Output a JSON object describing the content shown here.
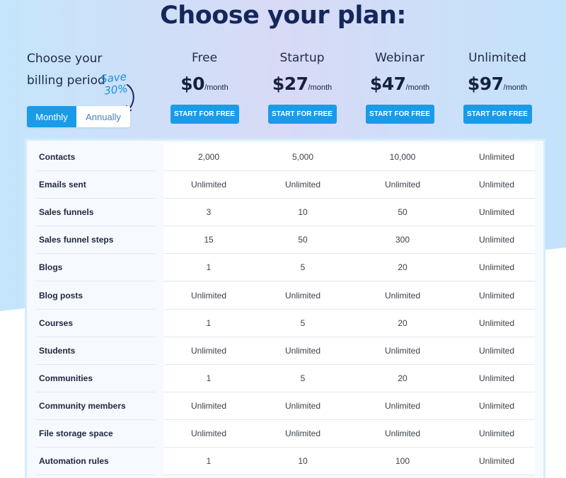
{
  "page": {
    "title": "Choose your plan:",
    "colors": {
      "accent": "#1a9be8",
      "title": "#15275a",
      "bg_light_blue": "#c6e6fb",
      "bg_lavender": "#d7dcf6"
    }
  },
  "billing": {
    "label": "Choose your billing period",
    "save_note_line1": "Save",
    "save_note_line2": "30%",
    "options": [
      {
        "label": "Monthly",
        "selected": true
      },
      {
        "label": "Annually",
        "selected": false
      }
    ]
  },
  "plans": [
    {
      "name": "Free",
      "price": "$0",
      "period": "/month",
      "cta": "START FOR FREE"
    },
    {
      "name": "Startup",
      "price": "$27",
      "period": "/month",
      "cta": "START FOR FREE"
    },
    {
      "name": "Webinar",
      "price": "$47",
      "period": "/month",
      "cta": "START FOR FREE"
    },
    {
      "name": "Unlimited",
      "price": "$97",
      "period": "/month",
      "cta": "START FOR FREE"
    }
  ],
  "features": [
    {
      "name": "Contacts",
      "values": [
        "2,000",
        "5,000",
        "10,000",
        "Unlimited"
      ]
    },
    {
      "name": "Emails sent",
      "values": [
        "Unlimited",
        "Unlimited",
        "Unlimited",
        "Unlimited"
      ]
    },
    {
      "name": "Sales funnels",
      "values": [
        "3",
        "10",
        "50",
        "Unlimited"
      ]
    },
    {
      "name": "Sales funnel steps",
      "values": [
        "15",
        "50",
        "300",
        "Unlimited"
      ]
    },
    {
      "name": "Blogs",
      "values": [
        "1",
        "5",
        "20",
        "Unlimited"
      ]
    },
    {
      "name": "Blog posts",
      "values": [
        "Unlimited",
        "Unlimited",
        "Unlimited",
        "Unlimited"
      ]
    },
    {
      "name": "Courses",
      "values": [
        "1",
        "5",
        "20",
        "Unlimited"
      ]
    },
    {
      "name": "Students",
      "values": [
        "Unlimited",
        "Unlimited",
        "Unlimited",
        "Unlimited"
      ]
    },
    {
      "name": "Communities",
      "values": [
        "1",
        "5",
        "20",
        "Unlimited"
      ]
    },
    {
      "name": "Community members",
      "values": [
        "Unlimited",
        "Unlimited",
        "Unlimited",
        "Unlimited"
      ]
    },
    {
      "name": "File storage space",
      "values": [
        "Unlimited",
        "Unlimited",
        "Unlimited",
        "Unlimited"
      ]
    },
    {
      "name": "Automation rules",
      "values": [
        "1",
        "10",
        "100",
        "Unlimited"
      ]
    }
  ]
}
